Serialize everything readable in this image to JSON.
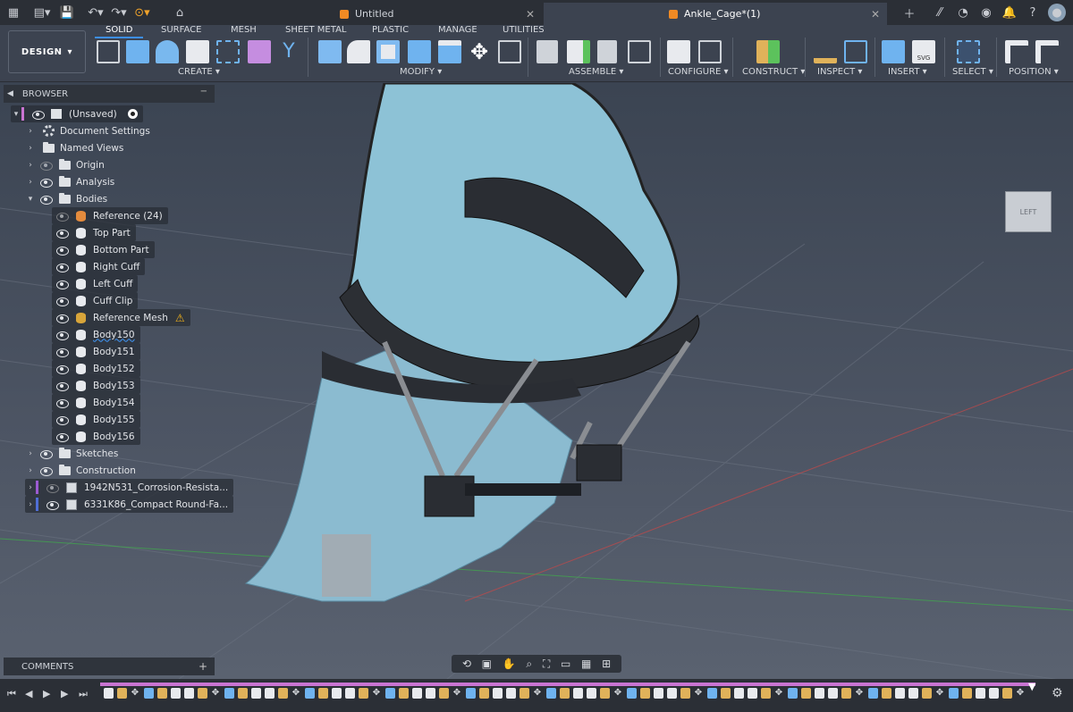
{
  "tabs": [
    {
      "label": "Untitled",
      "active": false
    },
    {
      "label": "Ankle_Cage*(1)",
      "active": true
    }
  ],
  "workspace": {
    "label": "DESIGN",
    "dropdown": "▾"
  },
  "ribbon_tabs": [
    {
      "label": "SOLID",
      "active": true
    },
    {
      "label": "SURFACE"
    },
    {
      "label": "MESH"
    },
    {
      "label": "SHEET METAL"
    },
    {
      "label": "PLASTIC"
    },
    {
      "label": "MANAGE"
    },
    {
      "label": "UTILITIES"
    }
  ],
  "groups": [
    {
      "label": "CREATE ▾"
    },
    {
      "label": "MODIFY ▾"
    },
    {
      "label": "ASSEMBLE ▾"
    },
    {
      "label": "CONFIGURE ▾"
    },
    {
      "label": "CONSTRUCT ▾"
    },
    {
      "label": "INSPECT ▾"
    },
    {
      "label": "INSERT ▾"
    },
    {
      "label": "SELECT ▾"
    },
    {
      "label": "POSITION ▾"
    }
  ],
  "browser": {
    "title": "BROWSER",
    "root": "(Unsaved)",
    "items": [
      {
        "label": "Document Settings"
      },
      {
        "label": "Named Views"
      },
      {
        "label": "Origin"
      },
      {
        "label": "Analysis"
      },
      {
        "label": "Bodies"
      },
      {
        "label": "Reference (24)"
      },
      {
        "label": "Top Part"
      },
      {
        "label": "Bottom Part"
      },
      {
        "label": "Right Cuff"
      },
      {
        "label": "Left Cuff"
      },
      {
        "label": "Cuff Clip"
      },
      {
        "label": "Reference Mesh"
      },
      {
        "label": "Body150"
      },
      {
        "label": "Body151"
      },
      {
        "label": "Body152"
      },
      {
        "label": "Body153"
      },
      {
        "label": "Body154"
      },
      {
        "label": "Body155"
      },
      {
        "label": "Body156"
      },
      {
        "label": "Sketches"
      },
      {
        "label": "Construction"
      },
      {
        "label": "1942N531_Corrosion-Resista..."
      },
      {
        "label": "6331K86_Compact Round-Fa..."
      }
    ]
  },
  "comments": {
    "label": "COMMENTS",
    "add": "+"
  },
  "viewcube": {
    "label": "LEFT"
  },
  "colors": {
    "accent": "#3d8ee8",
    "timeline": "#c974d2",
    "tab_icon": "#f08a24",
    "warning": "#f2b21b"
  }
}
